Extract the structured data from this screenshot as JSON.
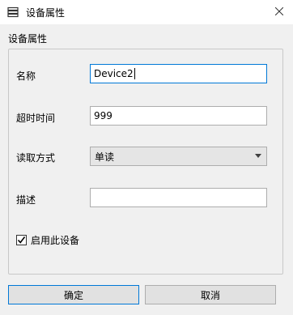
{
  "window": {
    "title": "设备属性",
    "icon": "list-icon",
    "close_icon": "close-icon"
  },
  "group": {
    "label": "设备属性"
  },
  "fields": {
    "name": {
      "label": "名称",
      "value": "Device2"
    },
    "timeout": {
      "label": "超时时间",
      "value": "999"
    },
    "read_mode": {
      "label": "读取方式",
      "value": "单读"
    },
    "description": {
      "label": "描述",
      "value": ""
    }
  },
  "enable": {
    "label": "启用此设备",
    "checked": true
  },
  "buttons": {
    "ok": "确定",
    "cancel": "取消"
  },
  "colors": {
    "accent": "#0078d7",
    "window_bg": "#f0f0f0"
  }
}
